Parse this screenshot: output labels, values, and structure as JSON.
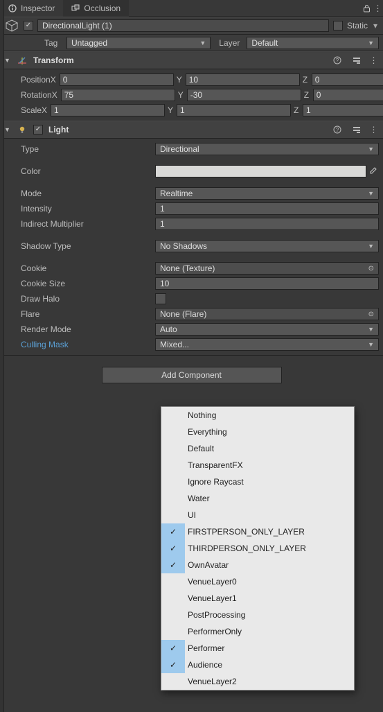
{
  "tabs": {
    "inspector": "Inspector",
    "occlusion": "Occlusion"
  },
  "header": {
    "name": "DirectionalLight (1)",
    "static_label": "Static"
  },
  "taglayer": {
    "tag_label": "Tag",
    "tag_value": "Untagged",
    "layer_label": "Layer",
    "layer_value": "Default"
  },
  "transform": {
    "title": "Transform",
    "position_label": "Position",
    "position": {
      "x": "0",
      "y": "10",
      "z": "0"
    },
    "rotation_label": "Rotation",
    "rotation": {
      "x": "75",
      "y": "-30",
      "z": "0"
    },
    "scale_label": "Scale",
    "scale": {
      "x": "1",
      "y": "1",
      "z": "1"
    }
  },
  "light": {
    "title": "Light",
    "type_label": "Type",
    "type_value": "Directional",
    "color_label": "Color",
    "color_value": "#d9d9d7",
    "mode_label": "Mode",
    "mode_value": "Realtime",
    "intensity_label": "Intensity",
    "intensity_value": "1",
    "indirect_label": "Indirect Multiplier",
    "indirect_value": "1",
    "shadow_label": "Shadow Type",
    "shadow_value": "No Shadows",
    "cookie_label": "Cookie",
    "cookie_value": "None (Texture)",
    "cookiesize_label": "Cookie Size",
    "cookiesize_value": "10",
    "drawhalo_label": "Draw Halo",
    "flare_label": "Flare",
    "flare_value": "None (Flare)",
    "rendermode_label": "Render Mode",
    "rendermode_value": "Auto",
    "culling_label": "Culling Mask",
    "culling_value": "Mixed..."
  },
  "add_component": "Add Component",
  "mask_popup": {
    "items": [
      {
        "label": "Nothing",
        "checked": false
      },
      {
        "label": "Everything",
        "checked": false
      },
      {
        "label": "Default",
        "checked": false
      },
      {
        "label": "TransparentFX",
        "checked": false
      },
      {
        "label": "Ignore Raycast",
        "checked": false
      },
      {
        "label": "Water",
        "checked": false
      },
      {
        "label": "UI",
        "checked": false
      },
      {
        "label": "FIRSTPERSON_ONLY_LAYER",
        "checked": true
      },
      {
        "label": "THIRDPERSON_ONLY_LAYER",
        "checked": true
      },
      {
        "label": "OwnAvatar",
        "checked": true
      },
      {
        "label": "VenueLayer0",
        "checked": false
      },
      {
        "label": "VenueLayer1",
        "checked": false
      },
      {
        "label": "PostProcessing",
        "checked": false
      },
      {
        "label": "PerformerOnly",
        "checked": false
      },
      {
        "label": "Performer",
        "checked": true
      },
      {
        "label": "Audience",
        "checked": true
      },
      {
        "label": "VenueLayer2",
        "checked": false
      }
    ]
  }
}
